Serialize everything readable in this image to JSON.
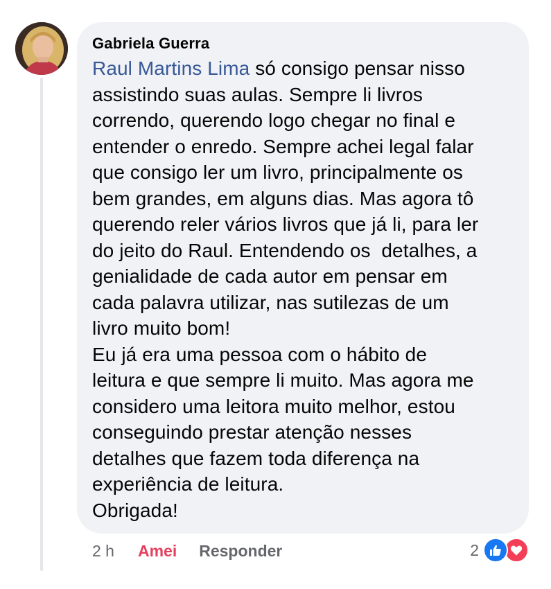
{
  "comment": {
    "author": "Gabriela Guerra",
    "mention": "Raul Martins Lima",
    "lines": [
      " só consigo pensar nisso",
      "assistindo suas aulas. Sempre li livros",
      "correndo, querendo logo chegar no final e",
      "entender o enredo. Sempre achei legal falar",
      "que consigo ler um livro, principalmente os",
      "bem grandes, em alguns dias. Mas agora tô",
      "querendo reler vários livros que já li, para ler",
      "do jeito do Raul. Entendendo os  detalhes, a",
      "genialidade de cada autor em pensar em",
      "cada palavra utilizar, nas sutilezas de um",
      "livro muito bom!",
      "Eu já era uma pessoa com o hábito de",
      "leitura e que sempre li muito. Mas agora me",
      "considero uma leitora muito melhor, estou",
      "conseguindo prestar atenção nesses",
      "detalhes que fazem toda diferença na",
      "experiência de leitura.",
      "Obrigada!"
    ]
  },
  "actions": {
    "time": "2 h",
    "react_label": "Amei",
    "reply_label": "Responder"
  },
  "reactions": {
    "count": "2",
    "icons": [
      "like-icon",
      "love-icon"
    ],
    "like_color": "#1877f2",
    "love_color": "#f33e58"
  },
  "colors": {
    "mention": "#385898",
    "react_active": "#e4405f",
    "bubble": "#f0f2f5"
  }
}
